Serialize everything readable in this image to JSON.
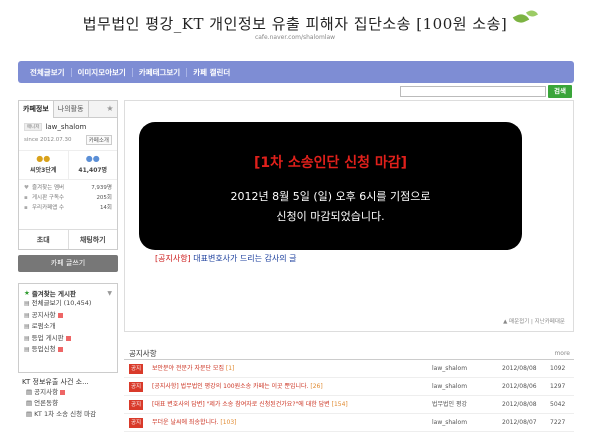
{
  "header": {
    "title": "법무법인 평강_KT 개인정보 유출 피해자 집단소송 [100원 소송]",
    "url": "cafe.naver.com/shalomlaw"
  },
  "nav": [
    "전체글보기",
    "이미지모아보기",
    "카페태그보기",
    "카페 캘린더"
  ],
  "search": {
    "placeholder": "",
    "button": "검색"
  },
  "sidebar": {
    "tabs": [
      "카페정보",
      "나의활동"
    ],
    "profile": {
      "badge": "매니저",
      "name": "law_shalom",
      "since": "since 2012.07.30",
      "invite": "카페소개"
    },
    "stats": [
      {
        "label": "씨앗3단계"
      },
      {
        "label": "41,407명"
      }
    ],
    "meta": [
      {
        "label": "즐겨찾는 멤버",
        "value": "7,939명"
      },
      {
        "label": "게시판 구독수",
        "value": "205회"
      },
      {
        "label": "우리카페앱 수",
        "value": "14회"
      }
    ],
    "actions": [
      "초대",
      "채팅하기"
    ],
    "write_button": "카페 글쓰기",
    "favorites": {
      "title": "즐겨찾는 게시판",
      "items": [
        "전체글보기 (10,454)",
        "공지사항",
        "로펌소개",
        "등업 게시판",
        "등업신청"
      ]
    },
    "section": "KT 정보유출 사건 소...",
    "tree": [
      "공지사항",
      "언론동향",
      "KT 1차 소송 신청 마감"
    ]
  },
  "banner": {
    "title": "[1차 소송인단 신청 마감]",
    "line1": "2012년 8월 5일 (일) 오후 6시를 기점으로",
    "line2": "신청이 마감되었습니다."
  },
  "notice_link": {
    "tag": "[공지사항]",
    "text": "대표변호사가 드리는 감사의 글"
  },
  "panel_footer": "▲ 매운접기 | 지난카페대문",
  "board": {
    "title": "공지사항",
    "more": "more",
    "rows": [
      {
        "tag": "공지",
        "title": "보안분야 전문가 자문단 모집",
        "count": "[1]",
        "author": "law_shalom",
        "date": "2012/08/08",
        "views": "1092"
      },
      {
        "tag": "공지",
        "title": "[공지사항] 법무법인 평강의 100원소송 카페는 이곳 뿐입니다.",
        "count": "[26]",
        "author": "law_shalom",
        "date": "2012/08/06",
        "views": "1297"
      },
      {
        "tag": "공지",
        "title": "[대표 변호사의 답변] \"제가 소송 참여자로 신청된건가요?\"에 대한 답변",
        "count": "[154]",
        "author": "법무법인 평강",
        "date": "2012/08/08",
        "views": "5042"
      },
      {
        "tag": "공지",
        "title": "무더운 날씨에 죄송합니다.",
        "count": "[103]",
        "author": "law_shalom",
        "date": "2012/08/07",
        "views": "7227"
      }
    ]
  },
  "colors": {
    "nav": "#7e8dd4",
    "search_button": "#3aa53a",
    "banner_title": "#e0201b",
    "tag": "#d93a2a"
  }
}
